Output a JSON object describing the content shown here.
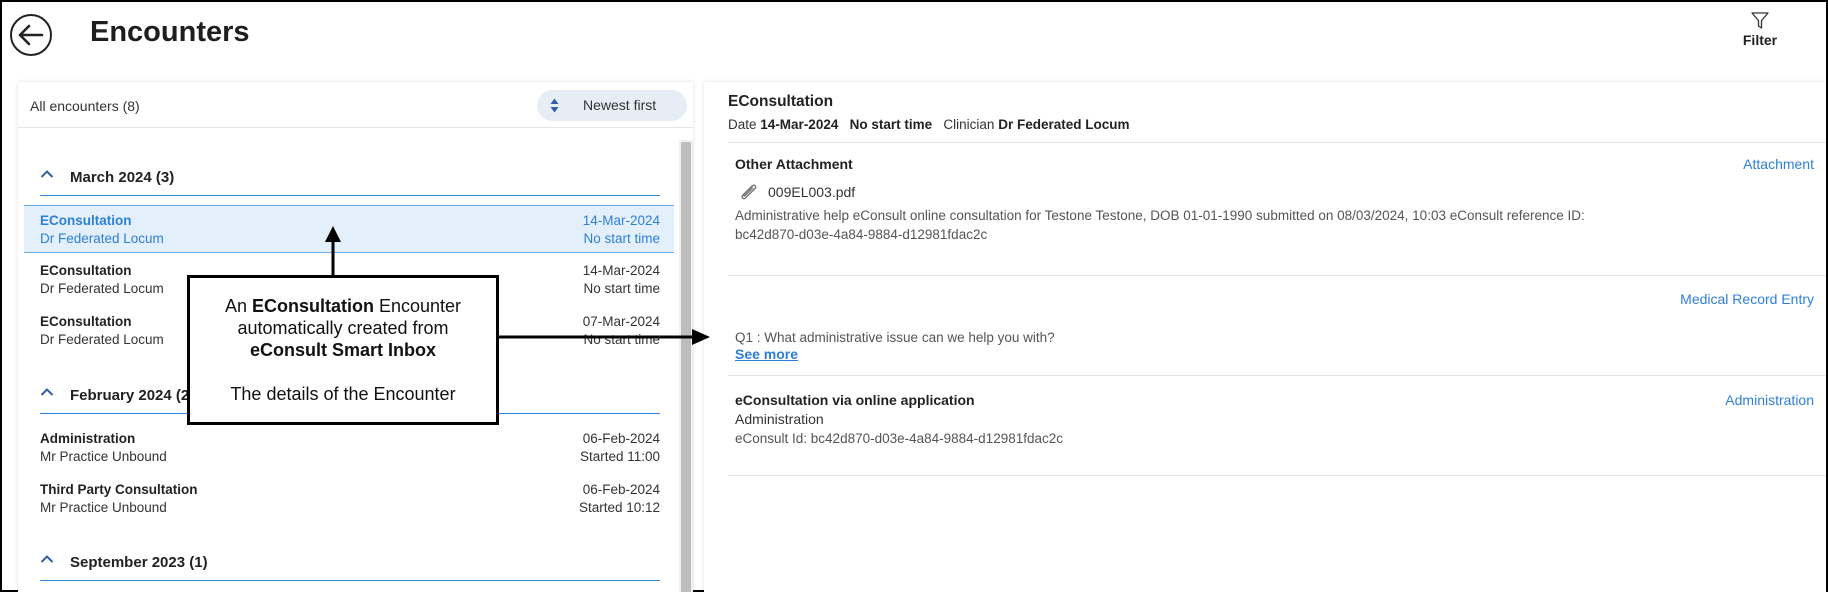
{
  "header": {
    "title": "Encounters",
    "filter_label": "Filter"
  },
  "list": {
    "count_label": "All encounters (8)",
    "sort_label": "Newest first",
    "groups": [
      {
        "title": "March 2024 (3)",
        "rows": [
          {
            "type": "EConsultation",
            "clinician": "Dr Federated Locum",
            "date": "14-Mar-2024",
            "time": "No start time",
            "selected": true
          },
          {
            "type": "EConsultation",
            "clinician": "Dr Federated Locum",
            "date": "14-Mar-2024",
            "time": "No start time"
          },
          {
            "type": "EConsultation",
            "clinician": "Dr Federated Locum",
            "date": "07-Mar-2024",
            "time": "No start time"
          }
        ]
      },
      {
        "title": "February 2024 (2)",
        "rows": [
          {
            "type": "Administration",
            "clinician": "Mr Practice Unbound",
            "date": "06-Feb-2024",
            "time": "Started 11:00"
          },
          {
            "type": "Third Party Consultation",
            "clinician": "Mr Practice Unbound",
            "date": "06-Feb-2024",
            "time": "Started 10:12"
          }
        ]
      },
      {
        "title": "September 2023 (1)",
        "rows": []
      }
    ]
  },
  "detail": {
    "title": "EConsultation",
    "date_label": "Date",
    "date": "14-Mar-2024",
    "start": "No start time",
    "clinician_label": "Clinician",
    "clinician": "Dr Federated Locum",
    "attachment_section": {
      "title": "Other Attachment",
      "link": "Attachment",
      "file": "009EL003.pdf",
      "desc_line1": "Administrative help eConsult online consultation for Testone Testone, DOB 01-01-1990 submitted on 08/03/2024, 10:03 eConsult reference ID:",
      "desc_line2": "bc42d870-d03e-4a84-9884-d12981fdac2c"
    },
    "medical_section": {
      "link": "Medical Record Entry",
      "question": "Q1 : What administrative issue can we help you with?",
      "see_more": "See more"
    },
    "admin_section": {
      "title": "eConsultation via online application",
      "link": "Administration",
      "subtitle": "Administration",
      "id_text": "eConsult Id: bc42d870-d03e-4a84-9884-d12981fdac2c"
    }
  },
  "callout": {
    "line1_prefix": "An ",
    "line1_bold": "EConsultation",
    "line1_suffix": " Encounter",
    "line2": "automatically created from",
    "line3": "eConsult Smart Inbox",
    "line4": "The details of the Encounter"
  },
  "colors": {
    "accent": "#2e7fd6",
    "selected_bg": "#e3f0fb",
    "sort_bg": "#e7edf5"
  }
}
